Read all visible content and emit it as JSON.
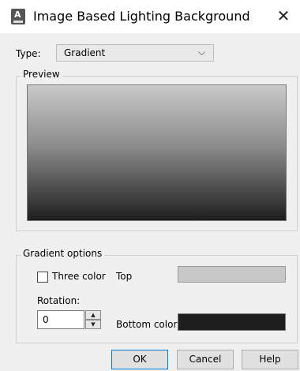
{
  "window": {
    "title": "Image Based Lighting Background",
    "close_glyph": "✕",
    "icon": "autocad-app-icon"
  },
  "type": {
    "label": "Type:",
    "value": "Gradient",
    "chevron": "⌵"
  },
  "preview": {
    "legend": "Preview"
  },
  "gradient_options": {
    "legend": "Gradient options",
    "three_color": {
      "label": "Three color",
      "checked": false
    },
    "top": {
      "label": "Top",
      "color": "#c8c8c8"
    },
    "rotation": {
      "label": "Rotation:",
      "value": "0"
    },
    "bottom": {
      "label": "Bottom color:",
      "color": "#1e1e1e"
    }
  },
  "buttons": {
    "ok": "OK",
    "cancel": "Cancel",
    "help": "Help"
  },
  "colors": {
    "preview_top": "#c9c9c9",
    "preview_bottom": "#1e1e1e"
  }
}
